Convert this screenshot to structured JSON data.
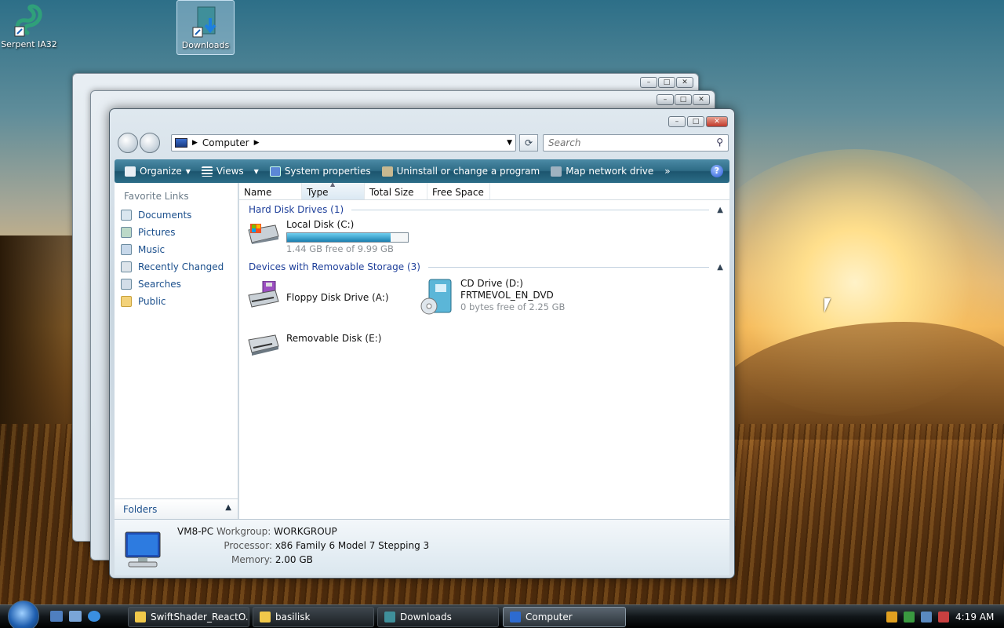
{
  "desktop": {
    "icons": [
      {
        "label": "Serpent IA32"
      },
      {
        "label": "Downloads"
      }
    ]
  },
  "window": {
    "address": {
      "location": "Computer"
    },
    "search": {
      "placeholder": "Search"
    },
    "toolbar": {
      "organize": "Organize",
      "views": "Views",
      "system_properties": "System properties",
      "uninstall": "Uninstall or change a program",
      "map_drive": "Map network drive",
      "more": "»",
      "help": "?"
    },
    "favorites": {
      "title": "Favorite Links",
      "items": [
        {
          "label": "Documents"
        },
        {
          "label": "Pictures"
        },
        {
          "label": "Music"
        },
        {
          "label": "Recently Changed"
        },
        {
          "label": "Searches"
        },
        {
          "label": "Public"
        }
      ],
      "folders_label": "Folders"
    },
    "columns": [
      "Name",
      "Type",
      "Total Size",
      "Free Space"
    ],
    "groups": {
      "hdd": {
        "title": "Hard Disk Drives (1)",
        "items": [
          {
            "name": "Local Disk (C:)",
            "detail": "1.44 GB free of 9.99 GB",
            "used_fraction": 0.856
          }
        ]
      },
      "removable": {
        "title": "Devices with Removable Storage (3)",
        "items": [
          {
            "name": "Floppy Disk Drive (A:)"
          },
          {
            "name": "CD Drive (D:)",
            "label": "FRTMEVOL_EN_DVD",
            "detail": "0 bytes free of 2.25 GB"
          },
          {
            "name": "Removable Disk (E:)"
          }
        ]
      }
    },
    "details": {
      "computer_name": "VM8-PC",
      "workgroup_label": "Workgroup:",
      "workgroup": "WORKGROUP",
      "processor_label": "Processor:",
      "processor": "x86 Family 6 Model 7 Stepping 3",
      "memory_label": "Memory:",
      "memory": "2.00 GB"
    }
  },
  "taskbar": {
    "buttons": [
      {
        "label": "SwiftShader_ReactO..."
      },
      {
        "label": "basilisk"
      },
      {
        "label": "Downloads"
      },
      {
        "label": "Computer"
      }
    ],
    "clock": "4:19 AM"
  }
}
